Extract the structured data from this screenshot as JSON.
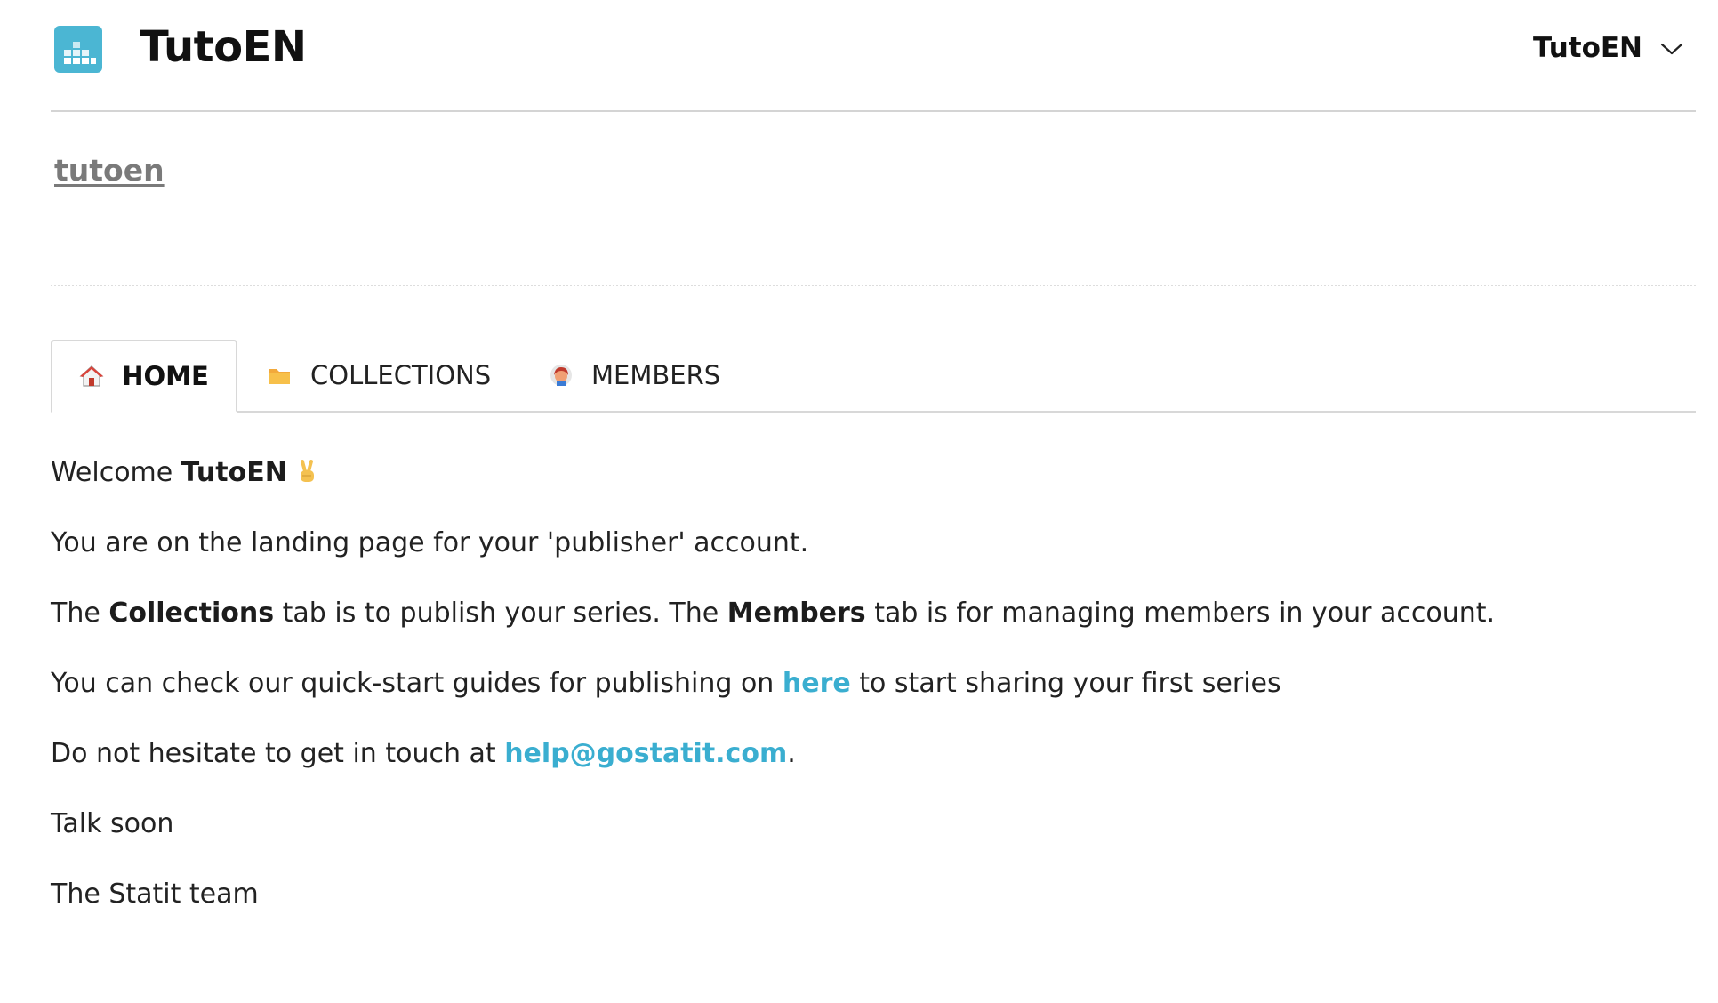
{
  "header": {
    "app_title": "TutoEN",
    "account_name": "TutoEN"
  },
  "account": {
    "slug": "tutoen"
  },
  "tabs": [
    {
      "label": "HOME",
      "icon": "house-icon",
      "active": true
    },
    {
      "label": "COLLECTIONS",
      "icon": "folder-icon",
      "active": false
    },
    {
      "label": "MEMBERS",
      "icon": "person-icon",
      "active": false
    }
  ],
  "home": {
    "welcome_prefix": "Welcome ",
    "welcome_name": "TutoEN",
    "welcome_icon": "victory-hand-icon",
    "line1": "You are on the landing page for your 'publisher' account.",
    "line2_part1": "The ",
    "line2_bold1": "Collections",
    "line2_part2": " tab is to publish your series. The ",
    "line2_bold2": "Members",
    "line2_part3": " tab is for managing members in your account.",
    "line3_part1": "You can check our quick-start guides for publishing on ",
    "line3_link": "here",
    "line3_part2": " to start sharing your first series",
    "line4_part1": "Do not hesitate to get in touch at ",
    "line4_link": "help@gostatit.com",
    "line4_part2": ".",
    "line5": "Talk soon",
    "line6": "The Statit team"
  },
  "colors": {
    "brand": "#4bb6d3",
    "link": "#3aaed0",
    "border": "#d8d8d8"
  }
}
